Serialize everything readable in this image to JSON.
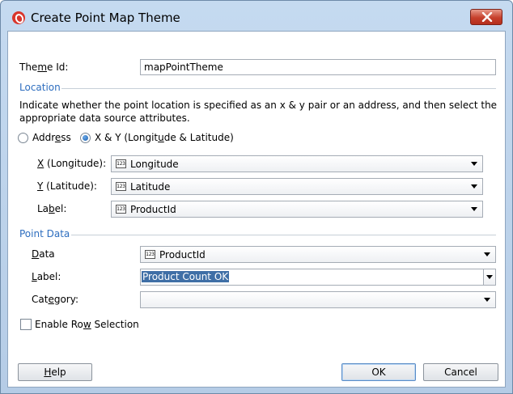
{
  "window": {
    "title": "Create Point Map Theme",
    "icon": "oracle-jdeveloper-icon"
  },
  "theme_id": {
    "label_pre": "The",
    "label_underlined": "m",
    "label_post": "e Id:",
    "value": "mapPointTheme"
  },
  "location": {
    "section_title": "Location",
    "description_line1": "Indicate whether the point location is specified as an x & y pair or an address, and then select the",
    "description_line2": "appropriate data source attributes.",
    "address_radio": {
      "label_pre": "Addr",
      "label_underlined": "e",
      "label_post": "ss",
      "checked": false
    },
    "xy_radio": {
      "label_pre": "X & Y (Longit",
      "label_underlined": "u",
      "label_post": "de & Latitude)",
      "checked": true
    },
    "x_field": {
      "label_underlined": "X",
      "label_post": " (Longitude):",
      "value": "Longitude",
      "type_icon": "123"
    },
    "y_field": {
      "label_underlined": "Y",
      "label_post": " (Latitude):",
      "value": "Latitude",
      "type_icon": "123"
    },
    "label_field": {
      "label_pre": "La",
      "label_underlined": "b",
      "label_post": "el:",
      "value": "ProductId",
      "type_icon": "123"
    }
  },
  "point_data": {
    "section_title": "Point Data",
    "data_field": {
      "label_pre": "",
      "label_underlined": "D",
      "label_post": "ata",
      "value": "ProductId",
      "type_icon": "123"
    },
    "label_field": {
      "label_pre": "",
      "label_underlined": "L",
      "label_post": "abel:",
      "value": "Product Count OK"
    },
    "category_field": {
      "label_pre": "Cat",
      "label_underlined": "e",
      "label_post": "gory:",
      "value": ""
    }
  },
  "enable_row_selection": {
    "label_pre": "Enable Ro",
    "label_underlined": "w",
    "label_post": " Selection",
    "checked": false
  },
  "buttons": {
    "help": {
      "label_underlined": "H",
      "label_post": "elp"
    },
    "ok": {
      "label": "OK"
    },
    "cancel": {
      "label": "Cancel"
    }
  },
  "colors": {
    "section_title": "#2e6ebf",
    "selection": "#3f6fa6",
    "close_button": "#c6402c"
  }
}
